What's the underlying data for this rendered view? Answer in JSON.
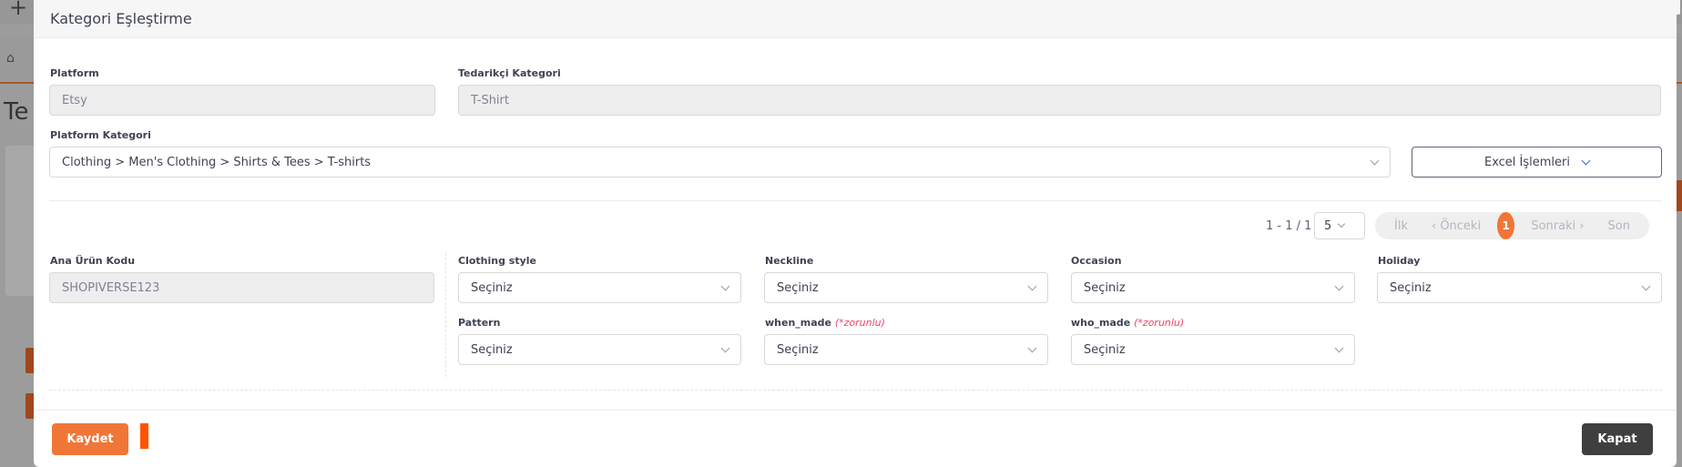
{
  "background": {
    "plus": "+",
    "close": "✕",
    "colors": {
      "accent": "#f07637",
      "dark": "#3f3f3f",
      "required": "#f1416c"
    }
  },
  "modal": {
    "title": "Kategori Eşleştirme",
    "platform": {
      "label": "Platform",
      "value": "Etsy"
    },
    "supplier_category": {
      "label": "Tedarikçi Kategori",
      "value": "T-Shirt"
    },
    "platform_category": {
      "label": "Platform Kategori",
      "value": "Clothing > Men's Clothing > Shirts & Tees > T-shirts"
    },
    "excel_button": "Excel İşlemleri",
    "pagination": {
      "info": "1 - 1 / 1",
      "page_size": "5",
      "first": "İlk",
      "prev": "‹ Önceki",
      "current": "1",
      "next": "Sonraki ›",
      "last": "Son"
    },
    "main_product_code": {
      "label": "Ana Ürün Kodu",
      "value": "SHOPIVERSE123"
    },
    "attributes": [
      {
        "label": "Clothing style",
        "required": "",
        "value": "Seçiniz"
      },
      {
        "label": "Neckline",
        "required": "",
        "value": "Seçiniz"
      },
      {
        "label": "Occasion",
        "required": "",
        "value": "Seçiniz"
      },
      {
        "label": "Holiday",
        "required": "",
        "value": "Seçiniz"
      },
      {
        "label": "Pattern",
        "required": "",
        "value": "Seçiniz"
      },
      {
        "label": "when_made",
        "required": "(*zorunlu)",
        "value": "Seçiniz"
      },
      {
        "label": "who_made",
        "required": "(*zorunlu)",
        "value": "Seçiniz"
      }
    ],
    "footer": {
      "save": "Kaydet",
      "close": "Kapat"
    }
  }
}
